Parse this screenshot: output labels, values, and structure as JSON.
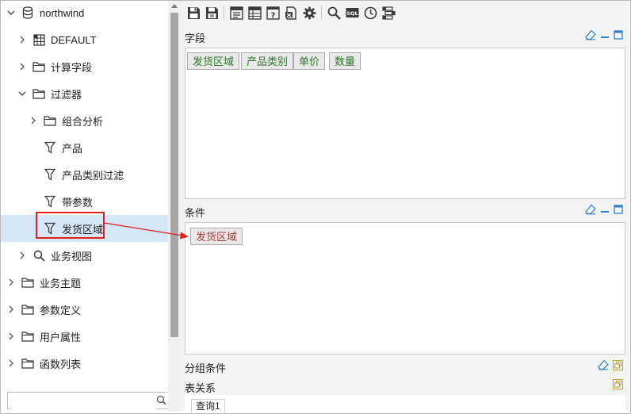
{
  "tree": {
    "root": "northwind",
    "items": [
      {
        "label": "DEFAULT",
        "icon": "table-grid-icon"
      },
      {
        "label": "计算字段",
        "icon": "folder-icon"
      },
      {
        "label": "过滤器",
        "icon": "folder-icon"
      },
      {
        "label": "组合分析",
        "icon": "folder-icon"
      },
      {
        "label": "产品",
        "icon": "filter-icon"
      },
      {
        "label": "产品类别过滤",
        "icon": "filter-icon"
      },
      {
        "label": "带参数",
        "icon": "filter-icon"
      },
      {
        "label": "发货区域",
        "icon": "filter-icon"
      },
      {
        "label": "业务视图",
        "icon": "search-icon"
      },
      {
        "label": "业务主题",
        "icon": "folder-icon"
      },
      {
        "label": "参数定义",
        "icon": "folder-icon"
      },
      {
        "label": "用户属性",
        "icon": "folder-icon"
      },
      {
        "label": "函数列表",
        "icon": "folder-icon"
      }
    ],
    "search_placeholder": ""
  },
  "toolbar": {
    "buttons": [
      "save-icon",
      "save-as-icon",
      "layout-icon",
      "table-layout-icon",
      "help-icon",
      "export-icon",
      "gear-icon",
      "search-icon",
      "sql-icon",
      "clock-icon",
      "settings-list-icon"
    ],
    "sql_text": "SQL"
  },
  "fields_section": {
    "title": "字段",
    "chips": [
      "发货区域",
      "产品类别",
      "单价",
      "数量"
    ],
    "accent_color": "#2a7a25"
  },
  "conditions_section": {
    "title": "条件",
    "chips": [
      "发货区域"
    ],
    "accent_color": "#b03b3b"
  },
  "group_conditions_section": {
    "title": "分组条件"
  },
  "table_relation_section": {
    "title": "表关系",
    "tab": "查询1"
  },
  "colors": {
    "selection": "#d5e6f7",
    "highlight": "#e02020",
    "window_icon": "#2a7fd4",
    "restore_icon": "#e49a1e"
  }
}
